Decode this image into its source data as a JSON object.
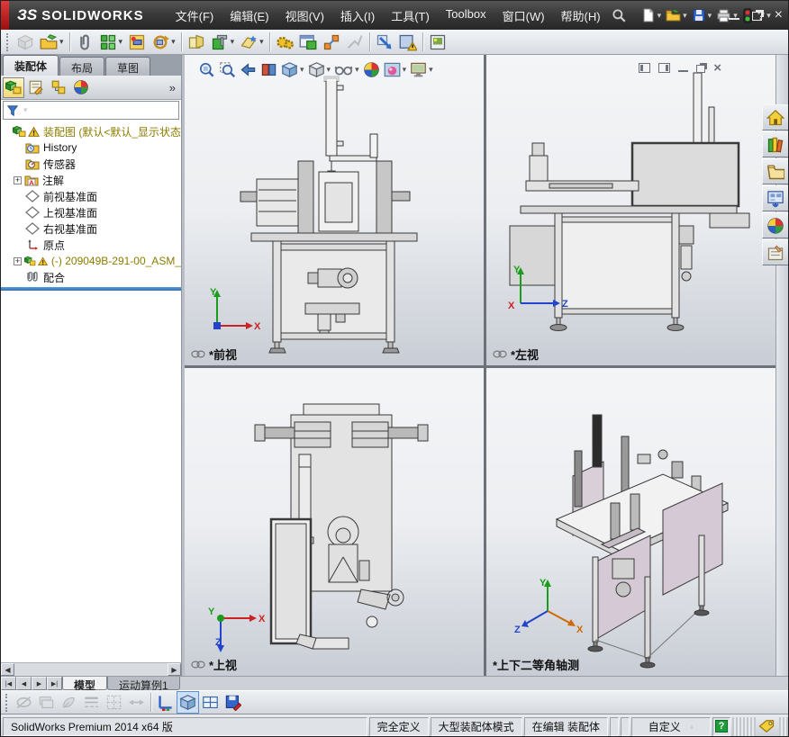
{
  "titlebar": {
    "brand_mark": "ЗS",
    "brand_name": "SOLIDWORKS",
    "menus": [
      "文件(F)",
      "编辑(E)",
      "视图(V)",
      "插入(I)",
      "工具(T)",
      "Toolbox",
      "窗口(W)",
      "帮助(H)"
    ]
  },
  "glyphs": {
    "dropdown": "▾",
    "chevron_more": "»",
    "expand": "+",
    "left_arrow": "◀",
    "right_arrow": "▶",
    "first": "|◀",
    "last": "▶|",
    "close": "×",
    "help": "?",
    "custom_up": "▴"
  },
  "quick_access": {
    "icons": [
      "new-document",
      "open",
      "save",
      "print",
      "performance-monitor",
      "help"
    ]
  },
  "assembly_toolbar": {
    "icons": [
      "insert-component",
      "open-insert",
      "mate",
      "linear-component-pattern",
      "smart-fasteners",
      "move-component",
      "show-hidden-components",
      "assembly-features",
      "reference-geometry",
      "new-motion-study",
      "bill-of-materials",
      "exploded-view",
      "explode-line-sketch",
      "interference-detection",
      "assembly-xpert",
      "snapshot"
    ]
  },
  "left_panel": {
    "tabs": [
      "装配体",
      "布局",
      "草图"
    ],
    "manager_tabs": [
      "featuremanager",
      "propertymanager",
      "configurationmanager",
      "displaymanager"
    ],
    "tree": [
      {
        "label": "装配图 (默认<默认_显示状态",
        "warning": true
      },
      {
        "label": "History"
      },
      {
        "label": "传感器"
      },
      {
        "label": "注解"
      },
      {
        "label": "前视基准面"
      },
      {
        "label": "上视基准面"
      },
      {
        "label": "右视基准面"
      },
      {
        "label": "原点"
      },
      {
        "label": "(-) 209049B-291-00_ASM_",
        "warning": true
      },
      {
        "label": "配合"
      }
    ]
  },
  "headsup_toolbar": {
    "icons": [
      "zoom-to-fit",
      "zoom-to-area",
      "previous-view",
      "section-view",
      "view-orientation",
      "display-style",
      "hide-show-items",
      "edit-appearance",
      "apply-scene",
      "view-settings"
    ]
  },
  "task_pane": {
    "icons": [
      "solidworks-resources-home",
      "design-library",
      "file-explorer",
      "view-palette",
      "appearances",
      "custom-properties"
    ]
  },
  "viewports": {
    "front": {
      "label": "*前视"
    },
    "left": {
      "label": "*左视"
    },
    "top": {
      "label": "*上视"
    },
    "isometric": {
      "label": "*上下二等角轴测"
    },
    "axis_labels": {
      "x": "X",
      "y": "Y",
      "z": "Z"
    }
  },
  "bottom_tabs": {
    "model": "模型",
    "motion_study": "运动算例1"
  },
  "status_bar": {
    "version": "SolidWorks Premium 2014 x64 版",
    "definition": "完全定义",
    "mode": "大型装配体模式",
    "editing": "在编辑 装配体",
    "custom": "自定义"
  },
  "colors": {
    "brand_red": "#c8102e",
    "titlebar_bg": "#3a3a3a",
    "tree_warning_text": "#8a7c00",
    "splitter_blue": "#2f6fbe",
    "iso_panel": "#d4c9d4",
    "axis_x": "#cc2222",
    "axis_y": "#1c9c1c",
    "axis_z": "#2244cc"
  }
}
